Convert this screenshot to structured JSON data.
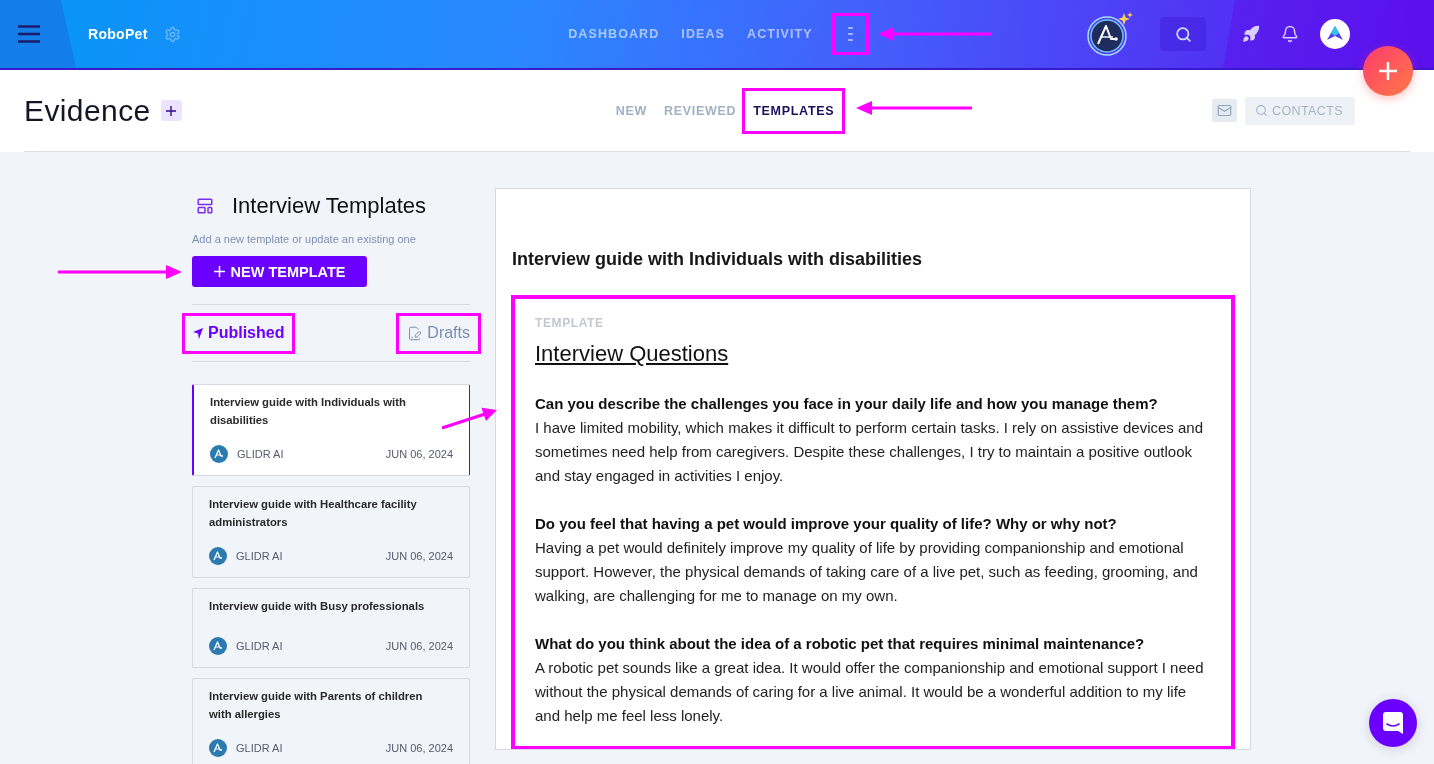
{
  "top_bar": {
    "app_name": "RoboPet",
    "nav": [
      {
        "label": "DASHBOARD",
        "highlighted": false
      },
      {
        "label": "IDEAS",
        "highlighted": false
      },
      {
        "label": "ACTIVITY",
        "highlighted": false
      }
    ],
    "more_menu": {
      "highlighted": true
    }
  },
  "page_header": {
    "title": "Evidence",
    "tabs": [
      {
        "label": "NEW",
        "selected": false,
        "highlighted": false
      },
      {
        "label": "REVIEWED",
        "selected": false,
        "highlighted": false
      },
      {
        "label": "TEMPLATES",
        "selected": true,
        "highlighted": true
      }
    ],
    "contacts_button": "CONTACTS"
  },
  "sidebar": {
    "title": "Interview Templates",
    "subtitle": "Add a new template or update an existing one",
    "new_button": "NEW TEMPLATE",
    "tabs": [
      {
        "kind": "published",
        "label": "Published",
        "selected": true,
        "highlighted": true
      },
      {
        "kind": "drafts",
        "label": "Drafts",
        "selected": false,
        "highlighted": true
      }
    ],
    "templates": [
      {
        "title": "Interview guide with Individuals with disabilities",
        "author": "GLIDR AI",
        "date": "JUN 06, 2024",
        "selected": true
      },
      {
        "title": "Interview guide with Healthcare facility administrators",
        "author": "GLIDR AI",
        "date": "JUN 06, 2024",
        "selected": false
      },
      {
        "title": "Interview guide with Busy professionals",
        "author": "GLIDR AI",
        "date": "JUN 06, 2024",
        "selected": false
      },
      {
        "title": "Interview guide with Parents of children with allergies",
        "author": "GLIDR AI",
        "date": "JUN 06, 2024",
        "selected": false
      }
    ]
  },
  "detail": {
    "title": "Interview guide with Individuals with disabilities",
    "document": {
      "label": "TEMPLATE",
      "heading": "Interview Questions",
      "highlighted": true,
      "items": [
        {
          "question": "Can you describe the challenges you face in your daily life and how you manage them?",
          "answer": "I have limited mobility, which makes it difficult to perform certain tasks. I rely on assistive devices and sometimes need help from caregivers. Despite these challenges, I try to maintain a positive outlook and stay engaged in activities I enjoy."
        },
        {
          "question": "Do you feel that having a pet would improve your quality of life? Why or why not?",
          "answer": "Having a pet would definitely improve my quality of life by providing companionship and emotional support. However, the physical demands of taking care of a live pet, such as feeding, grooming, and walking, are challenging for me to manage on my own."
        },
        {
          "question": "What do you think about the idea of a robotic pet that requires minimal maintenance?",
          "answer": "A robotic pet sounds like a great idea. It would offer the companionship and emotional support I need without the physical demands of caring for a live animal. It would be a wonderful addition to my life and help me feel less lonely."
        }
      ]
    }
  }
}
